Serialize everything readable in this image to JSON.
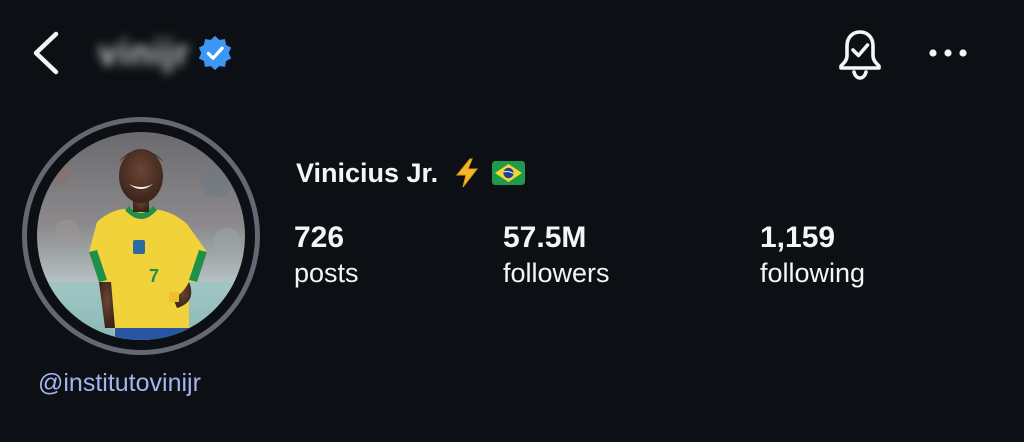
{
  "header": {
    "username": "vinijr",
    "back_icon": "chevron-left-icon",
    "verified_icon": "verified-badge-icon",
    "bell_icon": "notification-bell-check-icon",
    "more_icon": "more-horizontal-icon"
  },
  "profile": {
    "display_name": "Vinicius Jr.",
    "name_emojis": [
      "high-voltage-emoji",
      "brazil-flag-emoji"
    ],
    "mention": "@institutovinijr"
  },
  "stats": {
    "posts": {
      "value": "726",
      "label": "posts"
    },
    "followers": {
      "value": "57.5M",
      "label": "followers"
    },
    "following": {
      "value": "1,159",
      "label": "following"
    }
  },
  "colors": {
    "background": "#0c1014",
    "text": "#f5f5f5",
    "verified_blue": "#3b97f3",
    "mention": "#a5b4f0",
    "avatar_ring": "#646872"
  }
}
